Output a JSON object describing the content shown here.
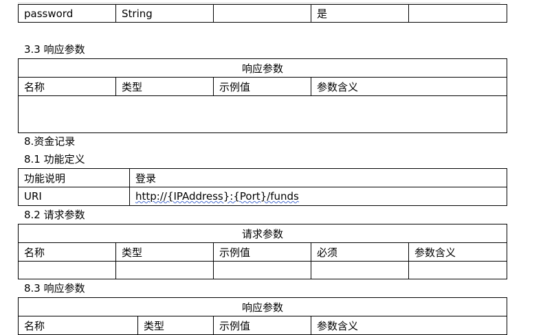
{
  "table_a": {
    "row": [
      "password",
      "String",
      "",
      "是",
      ""
    ]
  },
  "section_3_3": {
    "heading": "3.3 响应参数",
    "table_title": "响应参数",
    "headers": [
      "名称",
      "类型",
      "示例值",
      "参数含义"
    ]
  },
  "section_8": {
    "heading": "8.资金记录",
    "sub1_heading": "8.1 功能定义",
    "func_rows": [
      {
        "label": "功能说明",
        "value": "登录"
      },
      {
        "label": "URI",
        "value": "http://{IPAddress}:{Port}/funds"
      }
    ],
    "sub2_heading": "8.2 请求参数",
    "req_table_title": "请求参数",
    "req_headers": [
      "名称",
      "类型",
      "示例值",
      "必须",
      "参数含义"
    ],
    "sub3_heading": "8.3 响应参数",
    "resp_table_title": "响应参数",
    "resp_headers": [
      "名称",
      "类型",
      "示例值",
      "参数含义"
    ]
  }
}
